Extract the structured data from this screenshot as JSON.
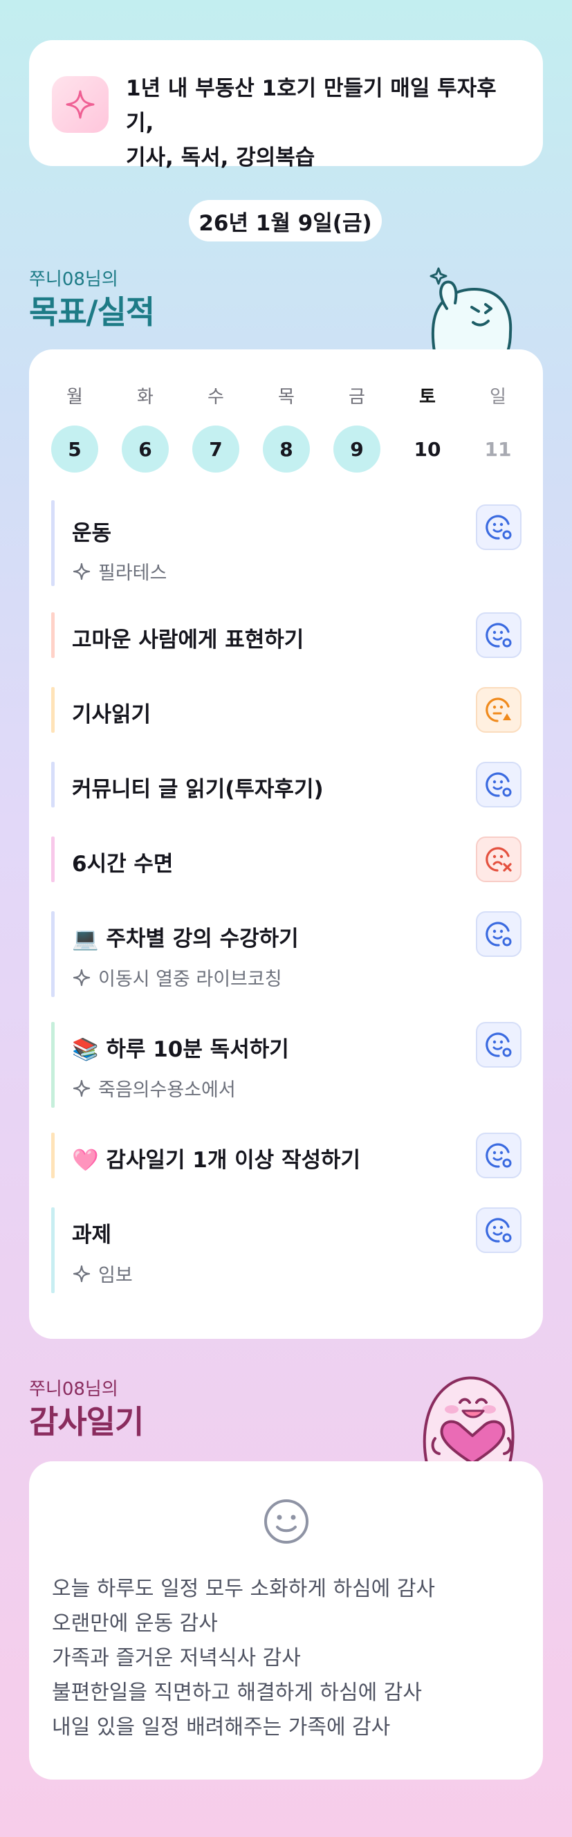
{
  "motto": {
    "icon": "sparkle-icon",
    "lines": [
      "1년 내 부동산 1호기 만들기 매일 투자후기,",
      "기사, 독서, 강의복습"
    ]
  },
  "date": "26년 1월 9일(금)",
  "goals_section": {
    "subtitle": "쭈니08님의",
    "title": "목표/실적"
  },
  "week": [
    {
      "name": "월",
      "day": "5",
      "state": "done"
    },
    {
      "name": "화",
      "day": "6",
      "state": "done"
    },
    {
      "name": "수",
      "day": "7",
      "state": "done"
    },
    {
      "name": "목",
      "day": "8",
      "state": "done"
    },
    {
      "name": "금",
      "day": "9",
      "state": "done"
    },
    {
      "name": "토",
      "day": "10",
      "state": "today"
    },
    {
      "name": "일",
      "day": "11",
      "state": "future"
    }
  ],
  "goals": [
    {
      "title": "운동",
      "sub": "필라테스",
      "bar_color": "#d7defa",
      "status": "done"
    },
    {
      "title": "고마운 사람에게 표현하기",
      "sub": "",
      "bar_color": "#ffd2c8",
      "status": "done"
    },
    {
      "title": "기사읽기",
      "sub": "",
      "bar_color": "#ffe3b8",
      "status": "partial"
    },
    {
      "title": "커뮤니티 글 읽기(투자후기)",
      "sub": "",
      "bar_color": "#d7defa",
      "status": "done"
    },
    {
      "title": "6시간 수면",
      "sub": "",
      "bar_color": "#f8c8ea",
      "status": "failed"
    },
    {
      "title": "💻 주차별 강의 수강하기",
      "sub": "이동시 열중 라이브코칭",
      "bar_color": "#d7defa",
      "status": "done"
    },
    {
      "title": "📚 하루 10분 독서하기",
      "sub": "죽음의수용소에서",
      "bar_color": "#c6efdb",
      "status": "done"
    },
    {
      "title": "🩷 감사일기 1개 이상 작성하기",
      "sub": "",
      "bar_color": "#ffe3b8",
      "status": "done"
    },
    {
      "title": "과제",
      "sub": "임보",
      "bar_color": "#c8eef2",
      "status": "done"
    }
  ],
  "gratitude_section": {
    "subtitle": "쭈니08님의",
    "title": "감사일기",
    "face_icon": "smile-face-icon",
    "lines": [
      "오늘 하루도 일정 모두 소화하게 하심에 감사",
      "오랜만에 운동 감사",
      "가족과 즐거운 저녁식사 감사",
      "불편한일을 직면하고 해결하게 하심에 감사",
      "내일 있을 일정 배려해주는 가족에 감사"
    ]
  },
  "colors": {
    "accent_teal": "#1d7b86",
    "accent_plum": "#8a2c5e",
    "status_done": "#3a6ae0",
    "status_partial": "#f08a1c",
    "status_failed": "#e4503e"
  }
}
